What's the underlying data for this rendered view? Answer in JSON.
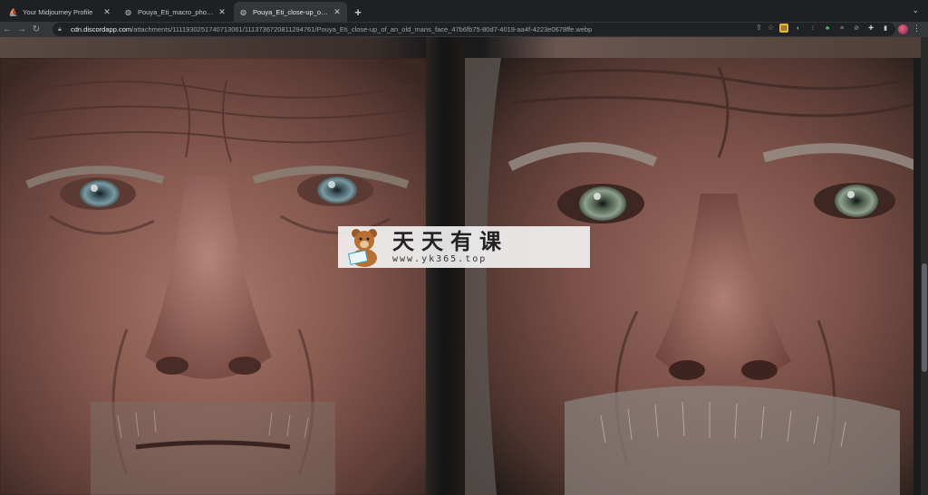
{
  "tabs": [
    {
      "title": "Your Midjourney Profile",
      "icon": "midjourney-icon",
      "active": false
    },
    {
      "title": "Pouya_Eti_macro_photo_of_a",
      "icon": "globe-icon",
      "active": false
    },
    {
      "title": "Pouya_Eti_close-up_of_an_ol",
      "icon": "globe-icon",
      "active": true
    }
  ],
  "new_tab_label": "+",
  "tabstrip_menu": "⌄",
  "toolbar": {
    "url_host": "cdn.discordapp.com",
    "url_path": "/attachments/1111930251740713061/1113736720811294761/Pouya_Eti_close-up_of_an_old_mans_face_47b6fb75-80d7-4019-aa4f-4223e0678ffe.webp"
  },
  "watermark": {
    "title": "天天有课",
    "url": "www.yk365.top"
  },
  "colors": {
    "tabstrip": "#1f2023",
    "toolbar": "#35363a",
    "omnibox": "#202124"
  }
}
